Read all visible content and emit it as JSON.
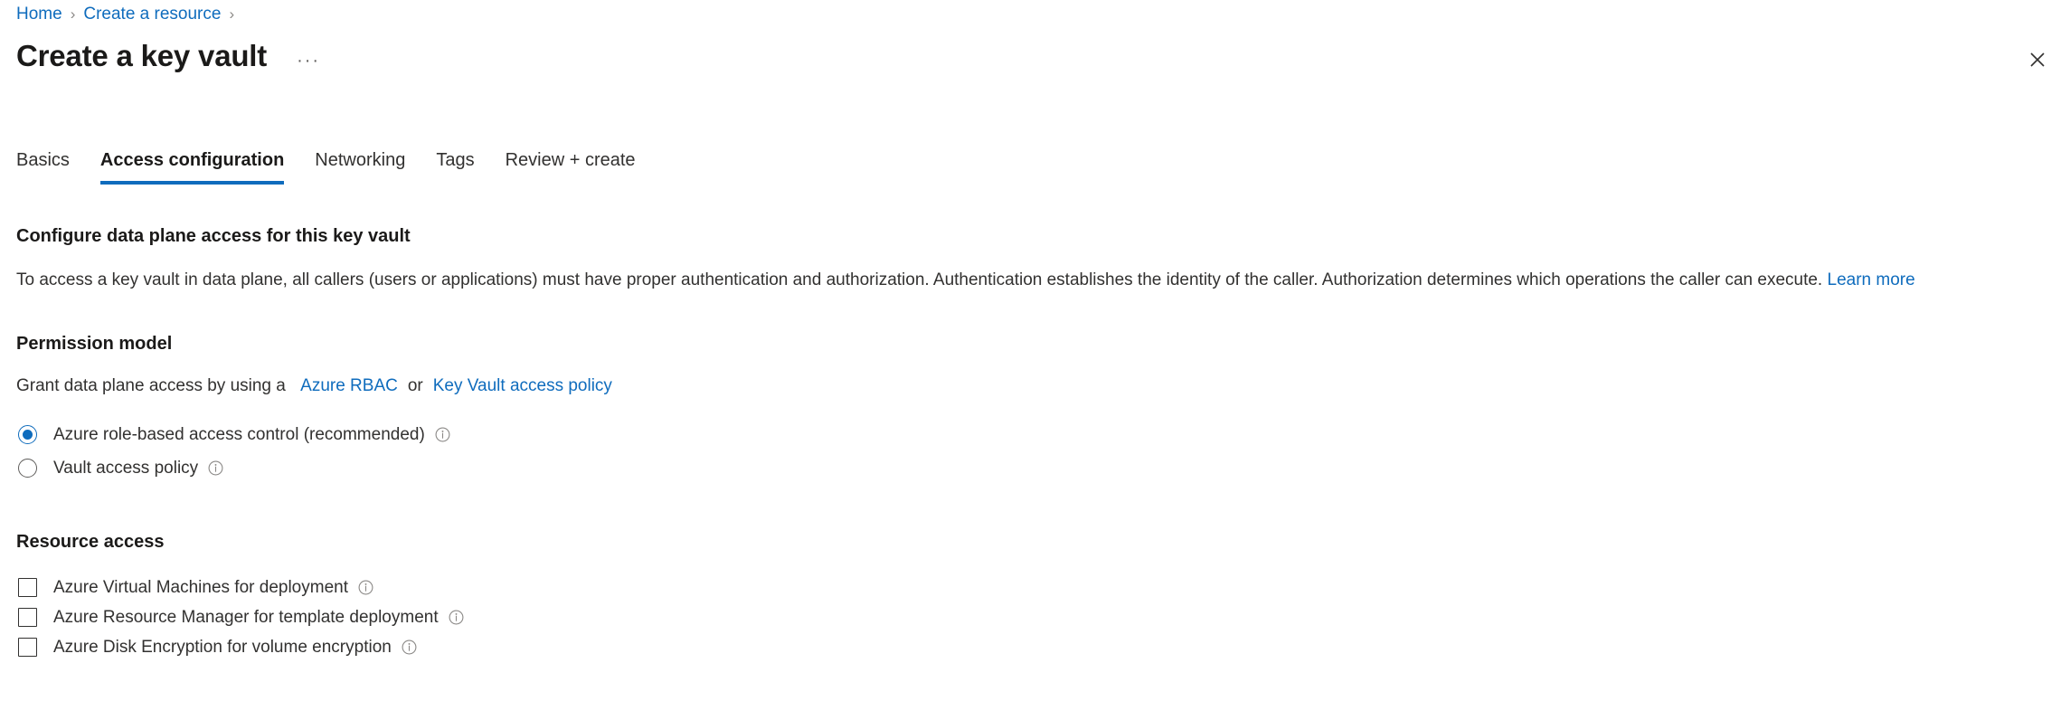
{
  "breadcrumb": {
    "items": [
      {
        "label": "Home"
      },
      {
        "label": "Create a resource"
      }
    ],
    "separator": "›"
  },
  "header": {
    "title": "Create a key vault",
    "more_menu_label": "···",
    "close_label": "Close"
  },
  "tabs": [
    {
      "label": "Basics",
      "active": false
    },
    {
      "label": "Access configuration",
      "active": true
    },
    {
      "label": "Networking",
      "active": false
    },
    {
      "label": "Tags",
      "active": false
    },
    {
      "label": "Review + create",
      "active": false
    }
  ],
  "main": {
    "section_heading": "Configure data plane access for this key vault",
    "description_text": "To access a key vault in data plane, all callers (users or applications) must have proper authentication and authorization. Authentication establishes the identity of the caller. Authorization determines which operations the caller can execute.",
    "description_link": "Learn more",
    "permission_model": {
      "heading": "Permission model",
      "intro_prefix": "Grant data plane access by using a",
      "link_rbac": "Azure RBAC",
      "intro_middle": "or",
      "link_policy": "Key Vault access policy",
      "options": [
        {
          "label": "Azure role-based access control (recommended)",
          "selected": true,
          "info": "info-icon"
        },
        {
          "label": "Vault access policy",
          "selected": false,
          "info": "info-icon"
        }
      ]
    },
    "resource_access": {
      "heading": "Resource access",
      "options": [
        {
          "label": "Azure Virtual Machines for deployment",
          "checked": false,
          "info": "info-icon"
        },
        {
          "label": "Azure Resource Manager for template deployment",
          "checked": false,
          "info": "info-icon"
        },
        {
          "label": "Azure Disk Encryption for volume encryption",
          "checked": false,
          "info": "info-icon"
        }
      ]
    }
  },
  "colors": {
    "accent": "#0f6cbd",
    "link": "#0f6cbd",
    "text": "#323130",
    "heading": "#1b1a19",
    "border": "#605e5c",
    "background": "#ffffff"
  }
}
